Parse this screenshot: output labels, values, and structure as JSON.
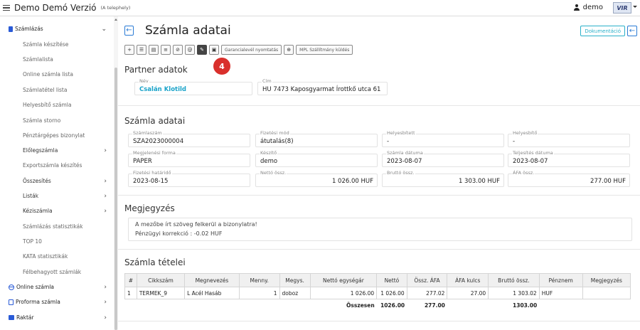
{
  "topbar": {
    "app_title": "Demo Demó Verzió",
    "app_subtitle": "(A telephely)",
    "user": "demo",
    "brand": "VIR"
  },
  "sidebar": {
    "items": [
      {
        "label": "Számlázás",
        "type": "top",
        "chevron": "⌄"
      },
      {
        "label": "Számla készítése",
        "type": "sub"
      },
      {
        "label": "Számlalista",
        "type": "sub"
      },
      {
        "label": "Online számla lista",
        "type": "sub"
      },
      {
        "label": "Számlatétel lista",
        "type": "sub"
      },
      {
        "label": "Helyesbítő számla",
        "type": "sub"
      },
      {
        "label": "Számla storno",
        "type": "sub"
      },
      {
        "label": "Pénztárgépes bizonylat",
        "type": "sub"
      },
      {
        "label": "Előlegszámla",
        "type": "subdark",
        "chevron": "›"
      },
      {
        "label": "Exportszámla készítés",
        "type": "sub"
      },
      {
        "label": "Összesítés",
        "type": "subdark",
        "chevron": "›"
      },
      {
        "label": "Listák",
        "type": "subdark",
        "chevron": "›"
      },
      {
        "label": "Kéziszámla",
        "type": "subdark",
        "chevron": "›"
      },
      {
        "label": "Számlázás statisztikák",
        "type": "sub"
      },
      {
        "label": "TOP 10",
        "type": "sub"
      },
      {
        "label": "KATA statisztikák",
        "type": "sub"
      },
      {
        "label": "Félbehagyott számlák",
        "type": "sub"
      },
      {
        "label": "Online számla",
        "type": "top",
        "chevron": "›"
      },
      {
        "label": "Proforma számla",
        "type": "top",
        "chevron": "›"
      },
      {
        "label": "Raktár",
        "type": "top",
        "chevron": "›"
      }
    ]
  },
  "main": {
    "title": "Számla adatai",
    "doc_button": "Dokumentáció",
    "toolbar": {
      "warranty_button": "Garancialevél nyomtatás",
      "mpl_button": "MPL Szállítmány küldés"
    },
    "badge": "4",
    "partner": {
      "section": "Partner adatok",
      "name_label": "Név",
      "name_value": "Csalán Klotild",
      "address_label": "Cím",
      "address_value": "HU 7473 Kaposgyarmat Írottkő utca 61"
    },
    "invoice": {
      "section": "Számla adatai",
      "fields": {
        "szamlaszam": {
          "label": "Számlaszám",
          "value": "SZA2023000004"
        },
        "fizetesi_mod": {
          "label": "Fizetési mód",
          "value": "átutalás(8)"
        },
        "helyesbitett": {
          "label": "Helyesbített",
          "value": "-"
        },
        "helyesbito": {
          "label": "Helyesbítő",
          "value": "-"
        },
        "megjelenesi_forma": {
          "label": "Megjelenési forma",
          "value": "PAPER"
        },
        "keszito": {
          "label": "Készítő",
          "value": "demo"
        },
        "szamla_datuma": {
          "label": "Számla dátuma",
          "value": "2023-08-07"
        },
        "teljesites_datuma": {
          "label": "Teljesítés dátuma",
          "value": "2023-08-07"
        },
        "fizetesi_hatarido": {
          "label": "Fizetési határidő",
          "value": "2023-08-15"
        },
        "netto": {
          "label": "Nettó össz.",
          "value": "1 026.00 HUF"
        },
        "brutto": {
          "label": "Bruttó össz.",
          "value": "1 303.00 HUF"
        },
        "afa": {
          "label": "ÁFA össz.",
          "value": "277.00 HUF"
        }
      }
    },
    "notes": {
      "section": "Megjegyzés",
      "line1": "A mezőbe írt szöveg felkerül a bizonylatra!",
      "line2": "Pénzügyi korrekció : -0.02 HUF"
    },
    "items": {
      "section": "Számla tételei",
      "headers": [
        "#",
        "Cikkszám",
        "Megnevezés",
        "Menny.",
        "Megys.",
        "Nettó egységár",
        "Nettó",
        "Össz. ÁFA",
        "ÁFA kulcs",
        "Bruttó össz.",
        "Pénznem",
        "Megjegyzés"
      ],
      "row": [
        "1",
        "TERMEK_9",
        "L Acél Hasáb",
        "1",
        "doboz",
        "1 026.00",
        "1 026.00",
        "277.02",
        "27.00",
        "1 303.02",
        "HUF",
        ""
      ],
      "total": {
        "label": "Összesen",
        "netto": "1026.00",
        "afa": "277.00",
        "brutto": "1303.00"
      }
    }
  }
}
